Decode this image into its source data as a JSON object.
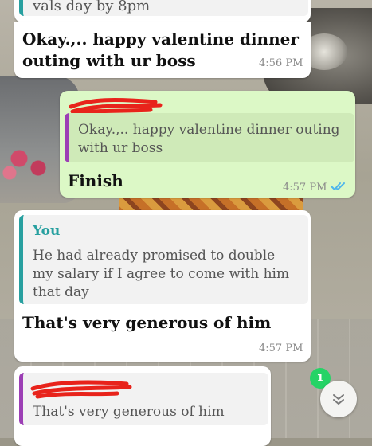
{
  "messages": [
    {
      "direction": "incoming",
      "text_partial": "vals day by 8pm"
    },
    {
      "direction": "incoming",
      "text": "Okay.,.. happy valentine dinner outing with ur boss",
      "line1": "Okay.,.. happy valentine dinner",
      "line2": "outing with ur boss",
      "time": "4:56 PM"
    },
    {
      "direction": "outgoing",
      "quoted_text_line1": "Okay.,.. happy valentine dinner outing",
      "quoted_text_line2": "with ur boss",
      "text": "Finish",
      "time": "4:57 PM",
      "status": "read"
    },
    {
      "direction": "incoming",
      "quoted_author": "You",
      "quoted_text_line1": "He had already promised to double",
      "quoted_text_line2": "my salary if I agree to come with him",
      "quoted_text_line3": "that day",
      "text": "That's very generous of him",
      "time": "4:57 PM"
    },
    {
      "direction": "incoming",
      "quoted_text": "That's very generous of him"
    }
  ],
  "unread_count": "1",
  "colors": {
    "incoming_bubble": "#ffffff",
    "outgoing_bubble": "#dcf8c6",
    "quote_teal": "#28a0a0",
    "quote_purple": "#9c3fb5",
    "read_ticks": "#4fb6ec",
    "badge_green": "#25d366",
    "redaction": "#e8231b"
  },
  "icons": [
    "double-check-icon",
    "chevron-down-icon"
  ]
}
